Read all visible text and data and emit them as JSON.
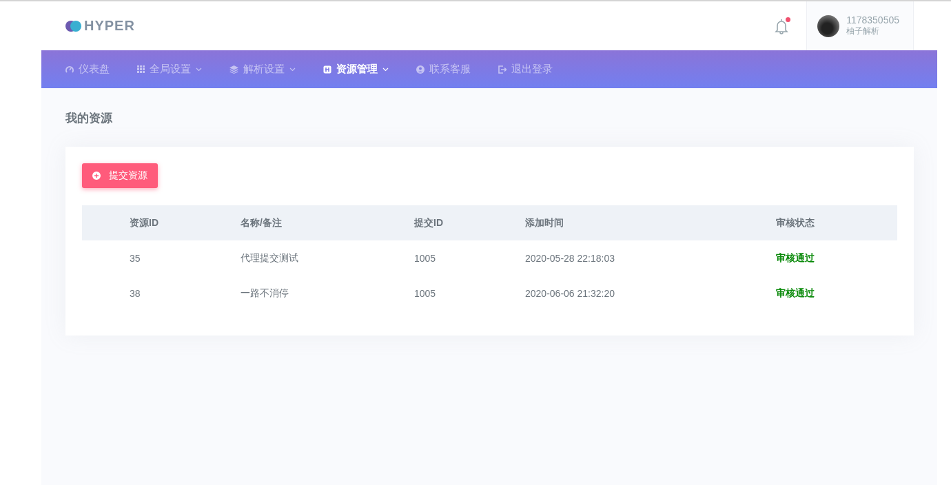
{
  "header": {
    "logo_text": "HYPER",
    "notification_unread": true,
    "user": {
      "name": "1178350505",
      "subtitle": "柚子解析"
    }
  },
  "nav": [
    {
      "label": "仪表盘",
      "kind": "gauge",
      "dropdown": false,
      "selected": false
    },
    {
      "label": "全局设置",
      "kind": "grid",
      "dropdown": true,
      "selected": false
    },
    {
      "label": "解析设置",
      "kind": "layers",
      "dropdown": true,
      "selected": false
    },
    {
      "label": "资源管理",
      "kind": "square",
      "dropdown": true,
      "selected": true
    },
    {
      "label": "联系客服",
      "kind": "user",
      "dropdown": false,
      "selected": false
    },
    {
      "label": "退出登录",
      "kind": "logout",
      "dropdown": false,
      "selected": false
    }
  ],
  "page_title": "我的资源",
  "submit_button": "提交资源",
  "table": {
    "columns": [
      {
        "label": "资源ID",
        "kind": "text"
      },
      {
        "label": "名称/备注",
        "kind": "text"
      },
      {
        "label": "提交ID",
        "kind": "text"
      },
      {
        "label": "添加时间",
        "kind": "text"
      },
      {
        "label": "审核状态",
        "kind": "status"
      }
    ],
    "rows": [
      [
        "35",
        "代理提交测试",
        "1005",
        "2020-05-28 22:18:03",
        "审核通过"
      ],
      [
        "38",
        "一路不消停",
        "1005",
        "2020-06-06 21:32:20",
        "审核通过"
      ]
    ]
  }
}
